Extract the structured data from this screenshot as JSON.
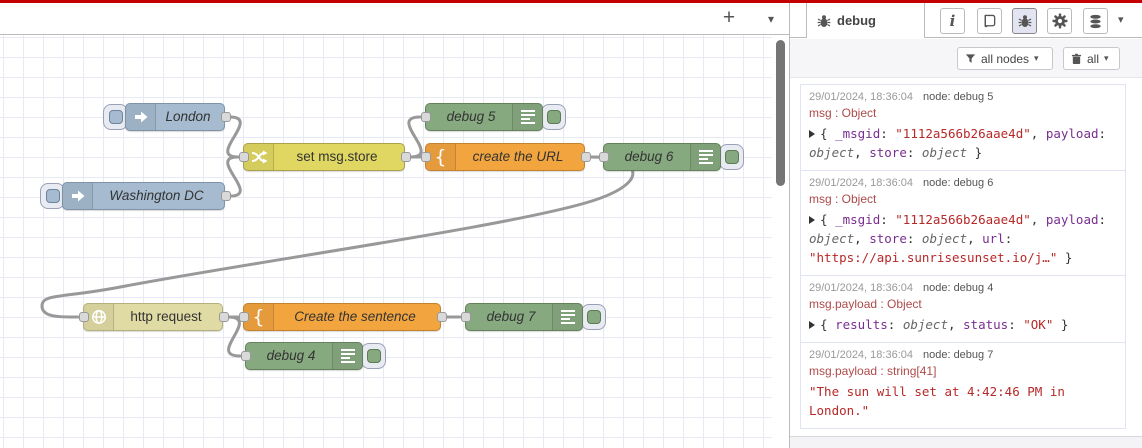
{
  "palette": {
    "header_red": "#c40000",
    "inject_fill": "#a6bbcf",
    "change_fill": "#e0d762",
    "function_fill": "#f2a43f",
    "debug_fill": "#87a980",
    "http_fill": "#e0dba4",
    "wire_color": "#999999",
    "key_color": "#792e90",
    "string_color": "#b72828",
    "meta_color": "#666666",
    "path_color": "#ad4a4a"
  },
  "workspace_header": {
    "add_button": "+",
    "dropdown": "▾"
  },
  "canvas": {
    "nodes": [
      {
        "label": "London",
        "type": "inject"
      },
      {
        "label": "Washington DC",
        "type": "inject"
      },
      {
        "label": "set msg.store",
        "type": "change"
      },
      {
        "label": "debug 5",
        "type": "debug"
      },
      {
        "label": "create the URL",
        "type": "function"
      },
      {
        "label": "debug 6",
        "type": "debug"
      },
      {
        "label": "http request",
        "type": "http request"
      },
      {
        "label": "Create the sentence",
        "type": "function"
      },
      {
        "label": "debug 7",
        "type": "debug"
      },
      {
        "label": "debug 4",
        "type": "debug"
      }
    ]
  },
  "sidebar": {
    "tab_label": "debug",
    "panel_chevron": "▾",
    "toolbar": {
      "filter_label": "all nodes",
      "clear_label": "all",
      "caret": "▾"
    },
    "messages": [
      {
        "timestamp": "29/01/2024, 18:36:04",
        "node": "node: debug 5",
        "path": "msg : Object",
        "tokens": [
          {
            "v": "{ "
          },
          {
            "v": "_msgid"
          },
          {
            "v": ": "
          },
          {
            "v": "\"1112a566b26aae4d\""
          },
          {
            "v": ", "
          },
          {
            "v": "payload"
          },
          {
            "v": ": "
          },
          {
            "v": "object"
          },
          {
            "v": ", "
          },
          {
            "v": "store"
          },
          {
            "v": ": "
          },
          {
            "v": "object"
          },
          {
            "v": " }"
          }
        ]
      },
      {
        "timestamp": "29/01/2024, 18:36:04",
        "node": "node: debug 6",
        "path": "msg : Object",
        "tokens": [
          {
            "v": "{ "
          },
          {
            "v": "_msgid"
          },
          {
            "v": ": "
          },
          {
            "v": "\"1112a566b26aae4d\""
          },
          {
            "v": ", "
          },
          {
            "v": "payload"
          },
          {
            "v": ": "
          },
          {
            "v": "object"
          },
          {
            "v": ", "
          },
          {
            "v": "store"
          },
          {
            "v": ": "
          },
          {
            "v": "object"
          },
          {
            "v": ", "
          },
          {
            "v": "url"
          },
          {
            "v": ": "
          },
          {
            "v": "\"https://api.sunrisesunset.io/j…\""
          },
          {
            "v": " }"
          }
        ]
      },
      {
        "timestamp": "29/01/2024, 18:36:04",
        "node": "node: debug 4",
        "path": "msg.payload : Object",
        "tokens": [
          {
            "v": "{ "
          },
          {
            "v": "results"
          },
          {
            "v": ": "
          },
          {
            "v": "object"
          },
          {
            "v": ", "
          },
          {
            "v": "status"
          },
          {
            "v": ": "
          },
          {
            "v": "\"OK\""
          },
          {
            "v": " }"
          }
        ]
      },
      {
        "timestamp": "29/01/2024, 18:36:04",
        "node": "node: debug 7",
        "path": "msg.payload : string[41]",
        "tokens": [
          {
            "v": "\"The sun will set at 4:42:46 PM in London.\""
          }
        ]
      }
    ]
  }
}
